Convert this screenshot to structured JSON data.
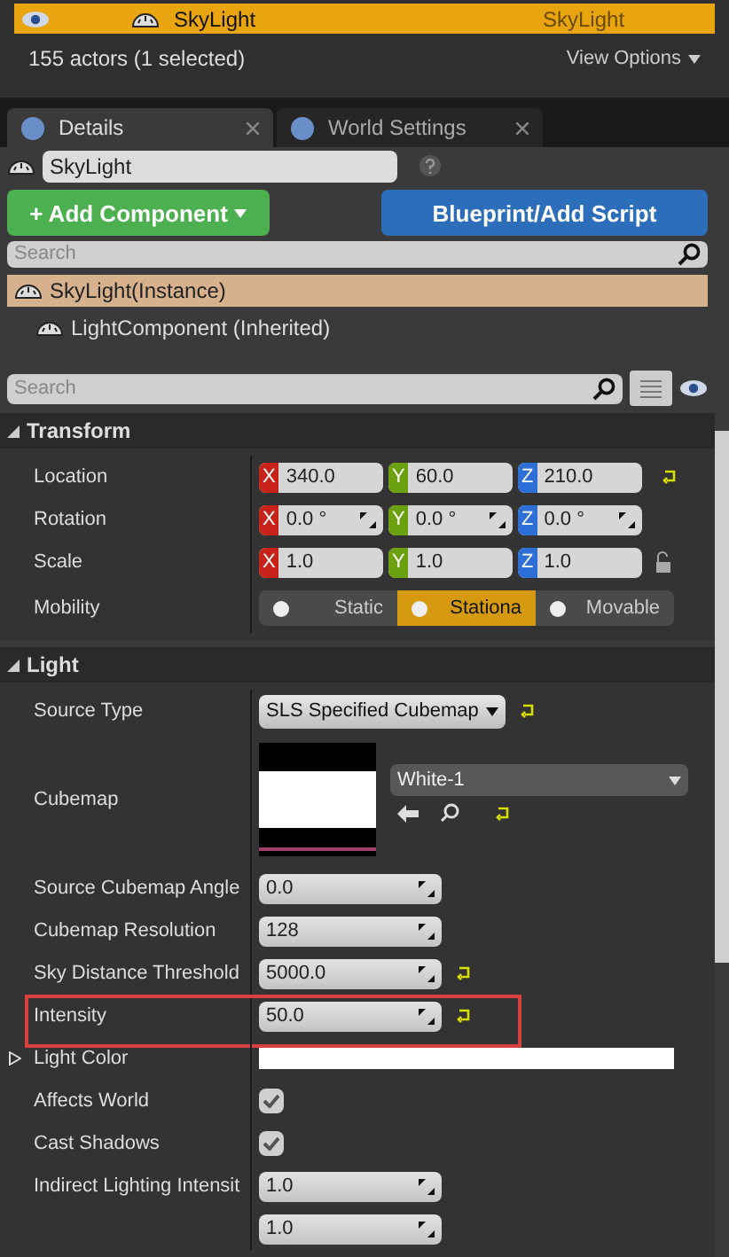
{
  "outliner": {
    "row": {
      "label": "SkyLight",
      "type": "SkyLight",
      "selected": true
    },
    "footer": "155 actors (1 selected)",
    "view_options": "View Options"
  },
  "tabs": [
    {
      "label": "Details",
      "selected": true
    },
    {
      "label": "World Settings",
      "selected": false
    }
  ],
  "actor_name": "SkyLight",
  "add_component": "+ Add Component",
  "blueprint_button": "Blueprint/Add Script",
  "component_search": {
    "placeholder": "Search"
  },
  "components": [
    {
      "label": "SkyLight(Instance)",
      "selected": true,
      "children": [
        {
          "label": "LightComponent (Inherited)",
          "selected": false
        }
      ]
    }
  ],
  "details_search": {
    "placeholder": "Search"
  },
  "sections": [
    {
      "title": "Transform",
      "expanded": true,
      "rows": [
        {
          "kind": "vector",
          "label": "Location",
          "spin": false,
          "reset": true,
          "lock": false,
          "values": [
            {
              "axis": "X",
              "value": "340.0"
            },
            {
              "axis": "Y",
              "value": "60.0"
            },
            {
              "axis": "Z",
              "value": "210.0"
            }
          ]
        },
        {
          "kind": "vector",
          "label": "Rotation",
          "spin": true,
          "reset": false,
          "lock": false,
          "values": [
            {
              "axis": "X",
              "value": "0.0 °"
            },
            {
              "axis": "Y",
              "value": "0.0 °"
            },
            {
              "axis": "Z",
              "value": "0.0 °"
            }
          ]
        },
        {
          "kind": "vector",
          "label": "Scale",
          "spin": false,
          "reset": false,
          "lock": true,
          "values": [
            {
              "axis": "X",
              "value": "1.0"
            },
            {
              "axis": "Y",
              "value": "1.0"
            },
            {
              "axis": "Z",
              "value": "1.0"
            }
          ]
        },
        {
          "kind": "mobility",
          "label": "Mobility",
          "options": [
            {
              "label": "Static",
              "selected": false
            },
            {
              "label": "Stationa",
              "selected": true
            },
            {
              "label": "Movable",
              "selected": false
            }
          ]
        }
      ]
    },
    {
      "title": "Light",
      "expanded": true,
      "rows": [
        {
          "kind": "dropdown",
          "label": "Source Type",
          "value": "SLS Specified Cubemap",
          "reset": true
        },
        {
          "kind": "asset",
          "label": "Cubemap",
          "value": "White-1",
          "reset": true
        },
        {
          "kind": "number",
          "label": "Source Cubemap Angle",
          "value": "0.0",
          "reset": false,
          "highlighted": false
        },
        {
          "kind": "number",
          "label": "Cubemap Resolution",
          "value": "128",
          "reset": false,
          "highlighted": false
        },
        {
          "kind": "number",
          "label": "Sky Distance Threshold",
          "value": "5000.0",
          "reset": true,
          "highlighted": false
        },
        {
          "kind": "number",
          "label": "Intensity",
          "value": "50.0",
          "reset": true,
          "highlighted": true
        },
        {
          "kind": "color",
          "label": "Light Color",
          "color": "#ffffff"
        },
        {
          "kind": "checkbox",
          "label": "Affects World",
          "checked": true
        },
        {
          "kind": "checkbox",
          "label": "Cast Shadows",
          "checked": true
        },
        {
          "kind": "number",
          "label": "Indirect Lighting Intensit",
          "value": "1.0",
          "reset": false,
          "highlighted": false
        },
        {
          "kind": "number",
          "value": "1.0",
          "reset": false,
          "highlighted": false
        }
      ]
    }
  ]
}
